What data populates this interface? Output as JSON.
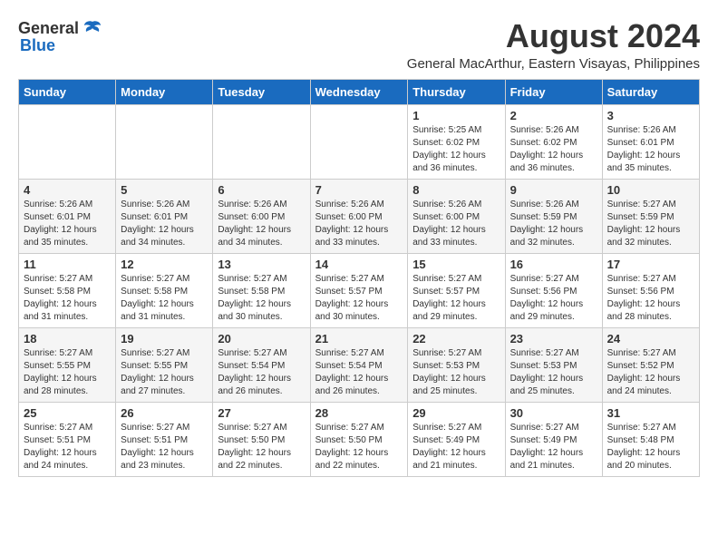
{
  "logo": {
    "general": "General",
    "blue": "Blue"
  },
  "title": {
    "month_year": "August 2024",
    "location": "General MacArthur, Eastern Visayas, Philippines"
  },
  "days_of_week": [
    "Sunday",
    "Monday",
    "Tuesday",
    "Wednesday",
    "Thursday",
    "Friday",
    "Saturday"
  ],
  "weeks": [
    [
      {
        "day": "",
        "info": ""
      },
      {
        "day": "",
        "info": ""
      },
      {
        "day": "",
        "info": ""
      },
      {
        "day": "",
        "info": ""
      },
      {
        "day": "1",
        "info": "Sunrise: 5:25 AM\nSunset: 6:02 PM\nDaylight: 12 hours\nand 36 minutes."
      },
      {
        "day": "2",
        "info": "Sunrise: 5:26 AM\nSunset: 6:02 PM\nDaylight: 12 hours\nand 36 minutes."
      },
      {
        "day": "3",
        "info": "Sunrise: 5:26 AM\nSunset: 6:01 PM\nDaylight: 12 hours\nand 35 minutes."
      }
    ],
    [
      {
        "day": "4",
        "info": "Sunrise: 5:26 AM\nSunset: 6:01 PM\nDaylight: 12 hours\nand 35 minutes."
      },
      {
        "day": "5",
        "info": "Sunrise: 5:26 AM\nSunset: 6:01 PM\nDaylight: 12 hours\nand 34 minutes."
      },
      {
        "day": "6",
        "info": "Sunrise: 5:26 AM\nSunset: 6:00 PM\nDaylight: 12 hours\nand 34 minutes."
      },
      {
        "day": "7",
        "info": "Sunrise: 5:26 AM\nSunset: 6:00 PM\nDaylight: 12 hours\nand 33 minutes."
      },
      {
        "day": "8",
        "info": "Sunrise: 5:26 AM\nSunset: 6:00 PM\nDaylight: 12 hours\nand 33 minutes."
      },
      {
        "day": "9",
        "info": "Sunrise: 5:26 AM\nSunset: 5:59 PM\nDaylight: 12 hours\nand 32 minutes."
      },
      {
        "day": "10",
        "info": "Sunrise: 5:27 AM\nSunset: 5:59 PM\nDaylight: 12 hours\nand 32 minutes."
      }
    ],
    [
      {
        "day": "11",
        "info": "Sunrise: 5:27 AM\nSunset: 5:58 PM\nDaylight: 12 hours\nand 31 minutes."
      },
      {
        "day": "12",
        "info": "Sunrise: 5:27 AM\nSunset: 5:58 PM\nDaylight: 12 hours\nand 31 minutes."
      },
      {
        "day": "13",
        "info": "Sunrise: 5:27 AM\nSunset: 5:58 PM\nDaylight: 12 hours\nand 30 minutes."
      },
      {
        "day": "14",
        "info": "Sunrise: 5:27 AM\nSunset: 5:57 PM\nDaylight: 12 hours\nand 30 minutes."
      },
      {
        "day": "15",
        "info": "Sunrise: 5:27 AM\nSunset: 5:57 PM\nDaylight: 12 hours\nand 29 minutes."
      },
      {
        "day": "16",
        "info": "Sunrise: 5:27 AM\nSunset: 5:56 PM\nDaylight: 12 hours\nand 29 minutes."
      },
      {
        "day": "17",
        "info": "Sunrise: 5:27 AM\nSunset: 5:56 PM\nDaylight: 12 hours\nand 28 minutes."
      }
    ],
    [
      {
        "day": "18",
        "info": "Sunrise: 5:27 AM\nSunset: 5:55 PM\nDaylight: 12 hours\nand 28 minutes."
      },
      {
        "day": "19",
        "info": "Sunrise: 5:27 AM\nSunset: 5:55 PM\nDaylight: 12 hours\nand 27 minutes."
      },
      {
        "day": "20",
        "info": "Sunrise: 5:27 AM\nSunset: 5:54 PM\nDaylight: 12 hours\nand 26 minutes."
      },
      {
        "day": "21",
        "info": "Sunrise: 5:27 AM\nSunset: 5:54 PM\nDaylight: 12 hours\nand 26 minutes."
      },
      {
        "day": "22",
        "info": "Sunrise: 5:27 AM\nSunset: 5:53 PM\nDaylight: 12 hours\nand 25 minutes."
      },
      {
        "day": "23",
        "info": "Sunrise: 5:27 AM\nSunset: 5:53 PM\nDaylight: 12 hours\nand 25 minutes."
      },
      {
        "day": "24",
        "info": "Sunrise: 5:27 AM\nSunset: 5:52 PM\nDaylight: 12 hours\nand 24 minutes."
      }
    ],
    [
      {
        "day": "25",
        "info": "Sunrise: 5:27 AM\nSunset: 5:51 PM\nDaylight: 12 hours\nand 24 minutes."
      },
      {
        "day": "26",
        "info": "Sunrise: 5:27 AM\nSunset: 5:51 PM\nDaylight: 12 hours\nand 23 minutes."
      },
      {
        "day": "27",
        "info": "Sunrise: 5:27 AM\nSunset: 5:50 PM\nDaylight: 12 hours\nand 22 minutes."
      },
      {
        "day": "28",
        "info": "Sunrise: 5:27 AM\nSunset: 5:50 PM\nDaylight: 12 hours\nand 22 minutes."
      },
      {
        "day": "29",
        "info": "Sunrise: 5:27 AM\nSunset: 5:49 PM\nDaylight: 12 hours\nand 21 minutes."
      },
      {
        "day": "30",
        "info": "Sunrise: 5:27 AM\nSunset: 5:49 PM\nDaylight: 12 hours\nand 21 minutes."
      },
      {
        "day": "31",
        "info": "Sunrise: 5:27 AM\nSunset: 5:48 PM\nDaylight: 12 hours\nand 20 minutes."
      }
    ]
  ]
}
